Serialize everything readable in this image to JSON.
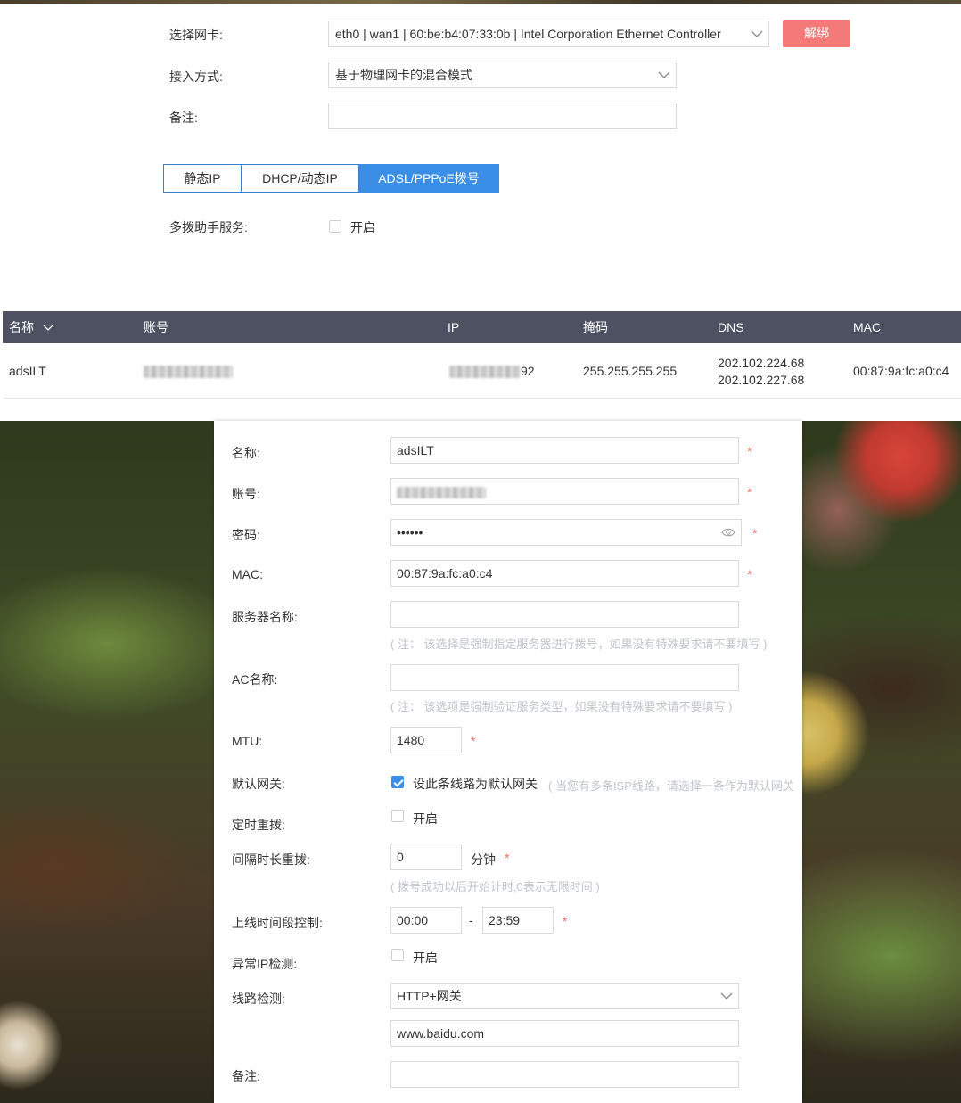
{
  "form": {
    "nic_label": "选择网卡:",
    "nic_value": "eth0 | wan1 | 60:be:b4:07:33:0b | Intel Corporation Ethernet Controller",
    "unbind_label": "解绑",
    "access_label": "接入方式:",
    "access_value": "基于物理网卡的混合模式",
    "remark_label": "备注:",
    "remark_value": ""
  },
  "tabs": [
    {
      "label": "静态IP",
      "active": false
    },
    {
      "label": "DHCP/动态IP",
      "active": false
    },
    {
      "label": "ADSL/PPPoE拨号",
      "active": true
    }
  ],
  "multi_dial": {
    "label": "多拨助手服务:",
    "checkbox_label": "开启",
    "checked": false
  },
  "table": {
    "columns": [
      "名称",
      "账号",
      "IP",
      "掩码",
      "DNS",
      "MAC"
    ],
    "rows": [
      {
        "name": "adsILT",
        "account": "",
        "ip_suffix": "92",
        "mask": "255.255.255.255",
        "dns1": "202.102.224.68",
        "dns2": "202.102.227.68",
        "mac": "00:87:9a:fc:a0:c4"
      }
    ]
  },
  "modal": {
    "name_label": "名称:",
    "name_value": "adsILT",
    "account_label": "账号:",
    "password_label": "密码:",
    "password_value": "••••••",
    "mac_label": "MAC:",
    "mac_value": "00:87:9a:fc:a0:c4",
    "server_label": "服务器名称:",
    "server_note": "( 注： 该选择是强制指定服务器进行拨号，如果没有特殊要求请不要填写 )",
    "ac_label": "AC名称:",
    "ac_note": "( 注： 该选项是强制验证服务类型，如果没有特殊要求请不要填写 )",
    "mtu_label": "MTU:",
    "mtu_value": "1480",
    "gateway_label": "默认网关:",
    "gateway_checkbox": "设此条线路为默认网关",
    "gateway_checked": true,
    "gateway_note": "( 当您有多条ISP线路，请选择一条作为默认网关",
    "redial_label": "定时重拨:",
    "redial_checkbox": "开启",
    "interval_label": "间隔时长重拨:",
    "interval_value": "0",
    "interval_unit": "分钟",
    "interval_note": "( 拨号成功以后开始计时,0表示无限时间 )",
    "online_label": "上线时间段控制:",
    "online_start": "00:00",
    "online_sep": "-",
    "online_end": "23:59",
    "abnormal_label": "异常IP检测:",
    "abnormal_checkbox": "开启",
    "line_label": "线路检测:",
    "line_value": "HTTP+网关",
    "line_host": "www.baidu.com",
    "remark_label": "备注:",
    "remark_value": "",
    "required_mark": "*"
  },
  "colors": {
    "header_bg": "#4d5161",
    "accent": "#3a8ee6",
    "danger": "#f47a7a",
    "required": "#f56c6c"
  }
}
